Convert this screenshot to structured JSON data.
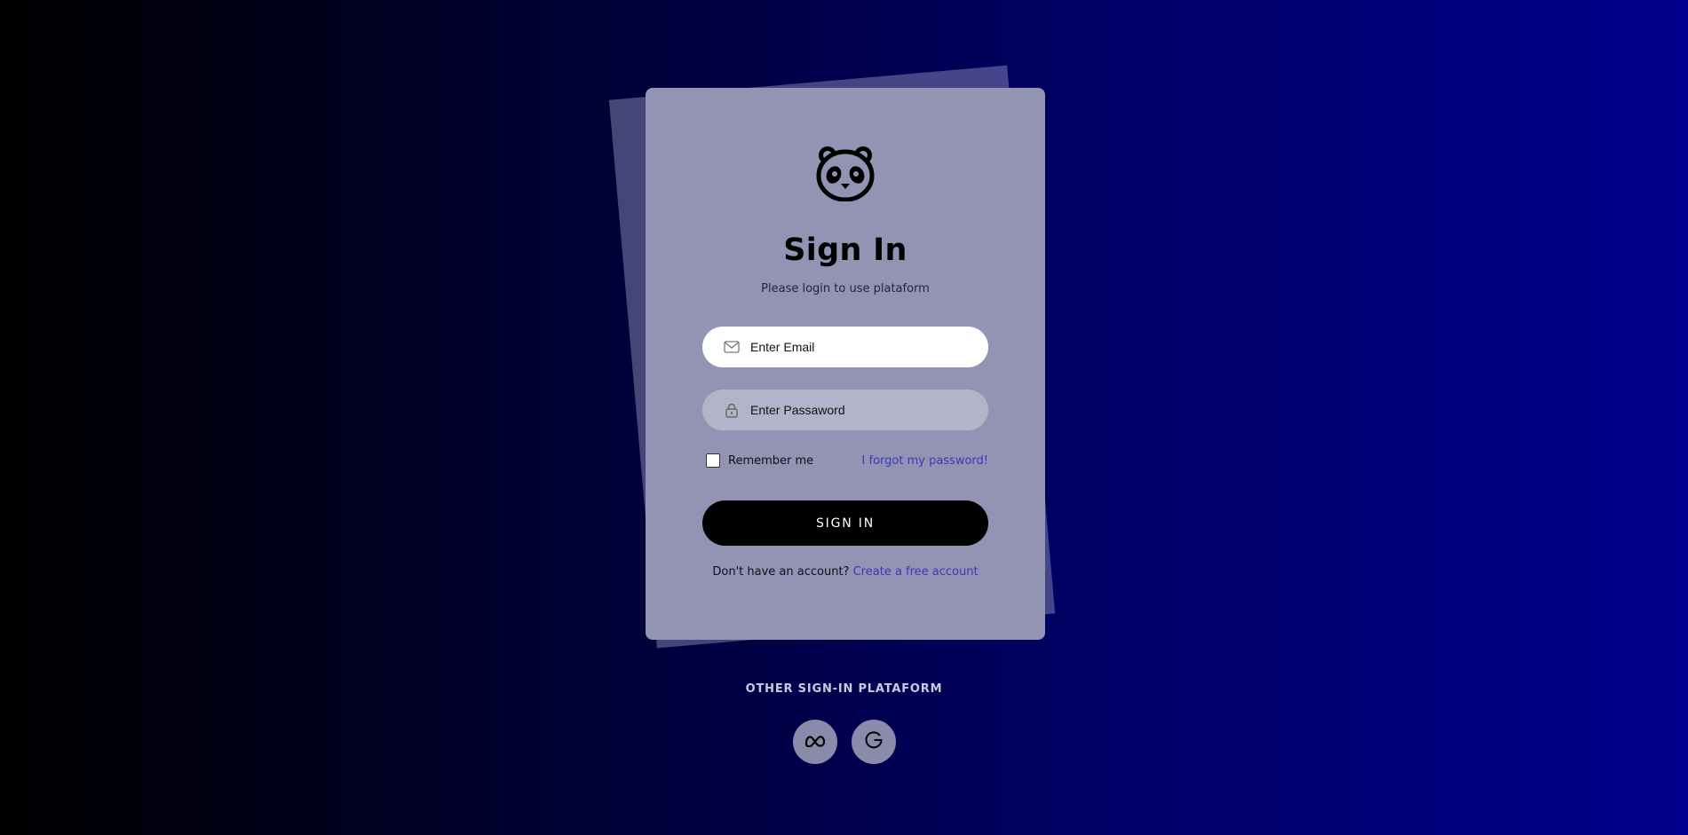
{
  "page": {
    "title": "Sign In",
    "subtitle": "Please login to use plataform"
  },
  "form": {
    "email": {
      "placeholder": "Enter Email",
      "value": "",
      "icon": "envelope-icon"
    },
    "password": {
      "placeholder": "Enter Passaword",
      "value": "",
      "icon": "lock-icon"
    },
    "remember_label": "Remember me",
    "remember_checked": false,
    "forgot_label": "I forgot my password!",
    "submit_label": "SIGN IN"
  },
  "register": {
    "prompt": "Don't have an account?",
    "link_label": "Create a free account"
  },
  "social": {
    "title": "OTHER SIGN-IN PLATAFORM",
    "items": [
      {
        "icon": "meta-icon"
      },
      {
        "icon": "google-icon"
      }
    ]
  },
  "colors": {
    "card": "#9393b3",
    "accent_link": "#3c38b8",
    "button": "#000000",
    "background_start": "#000000",
    "background_end": "#00008c"
  }
}
